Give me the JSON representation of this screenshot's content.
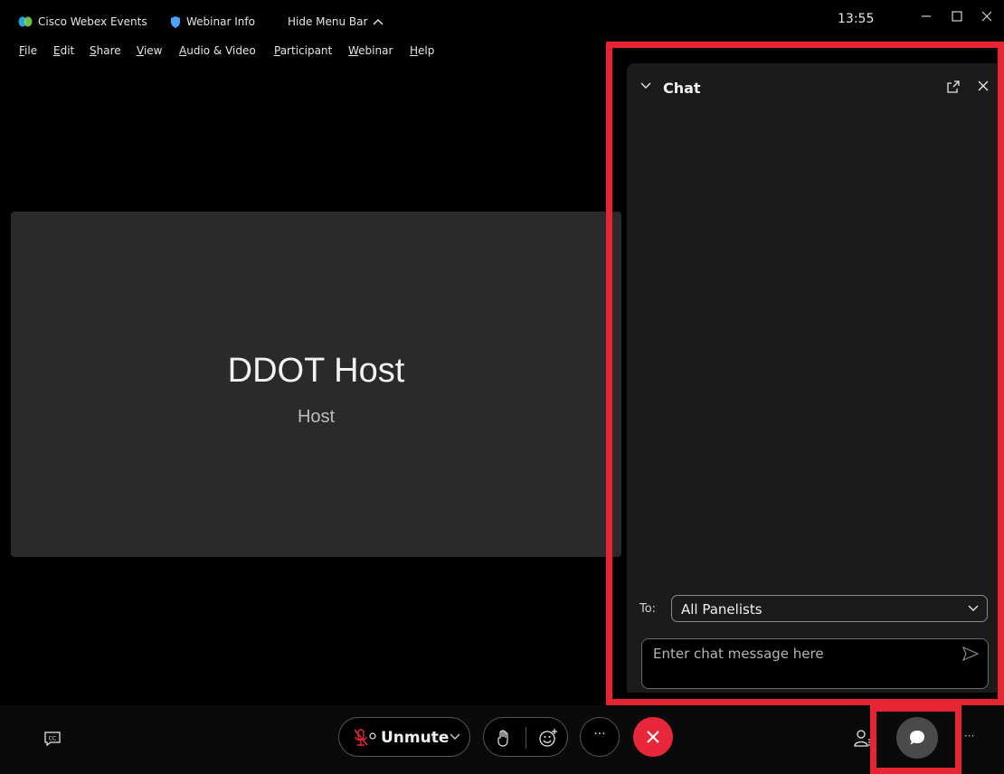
{
  "titlebar": {
    "app_name": "Cisco Webex Events",
    "webinar_info": "Webinar Info",
    "hide_menu": "Hide Menu Bar",
    "time": "13:55"
  },
  "menu": {
    "items": [
      {
        "u": "F",
        "rest": "ile"
      },
      {
        "u": "E",
        "rest": "dit"
      },
      {
        "u": "S",
        "rest": "hare"
      },
      {
        "u": "V",
        "rest": "iew"
      },
      {
        "u": "A",
        "rest": "udio & Video"
      },
      {
        "u": "P",
        "rest": "articipant"
      },
      {
        "u": "W",
        "rest": "ebinar"
      },
      {
        "u": "H",
        "rest": "elp"
      }
    ]
  },
  "stage": {
    "name": "DDOT Host",
    "role": "Host"
  },
  "chat": {
    "title": "Chat",
    "to_label": "To:",
    "to_value": "All Panelists",
    "input_placeholder": "Enter chat message here"
  },
  "toolbar": {
    "unmute_label": "Unmute",
    "more_label": "···",
    "overflow_label": "···"
  },
  "colors": {
    "highlight": "#e52532",
    "leave": "#e8283a",
    "stage_bg": "#2a2a2a",
    "panel_bg": "#1b1b1b"
  }
}
